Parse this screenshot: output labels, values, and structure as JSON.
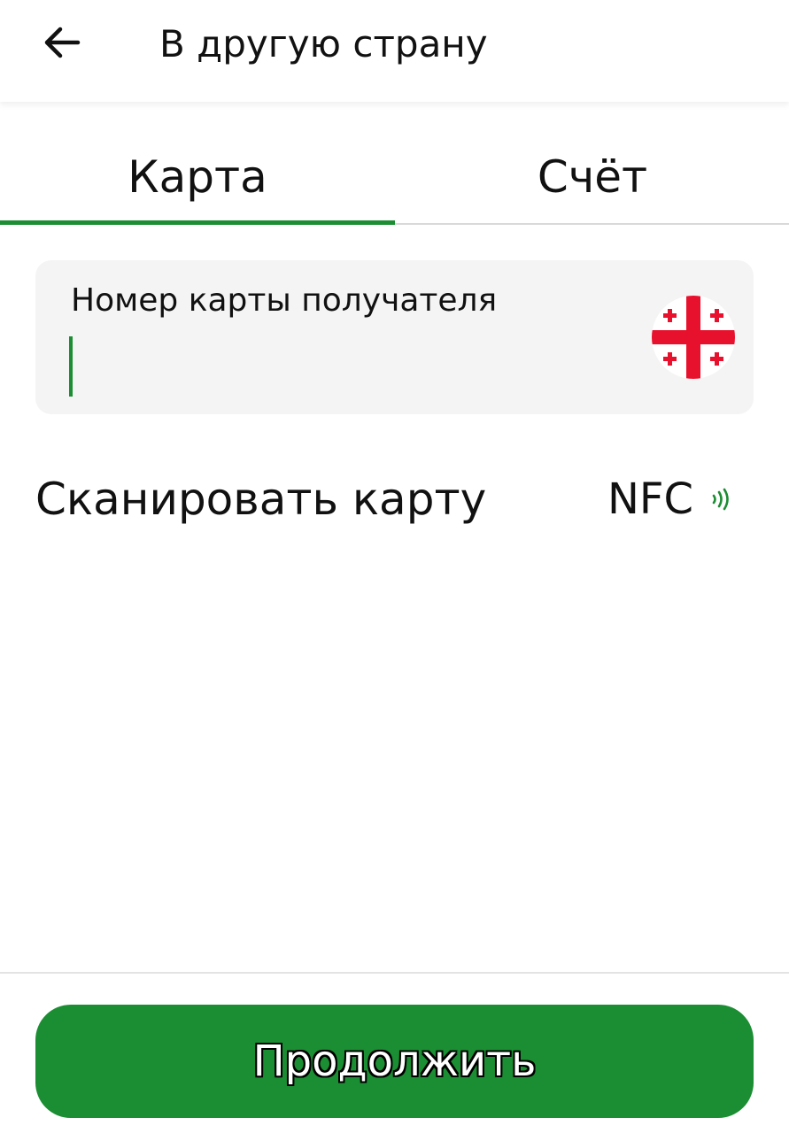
{
  "header": {
    "title": "В другую страну",
    "back_icon": "arrow-left-icon"
  },
  "tabs": [
    {
      "label": "Карта",
      "active": true
    },
    {
      "label": "Счёт",
      "active": false
    }
  ],
  "card_field": {
    "label": "Номер карты получателя",
    "value": "",
    "flag_icon": "georgia-flag-icon"
  },
  "scan": {
    "label": "Сканировать карту",
    "nfc_label": "NFC",
    "nfc_icon": "nfc-waves-icon"
  },
  "footer": {
    "continue_label": "Продолжить"
  },
  "colors": {
    "accent": "#1b8d32",
    "field_background": "#f4f4f4",
    "flag_red": "#e8112d",
    "flag_white": "#ffffff",
    "divider": "#d9d9d9"
  }
}
